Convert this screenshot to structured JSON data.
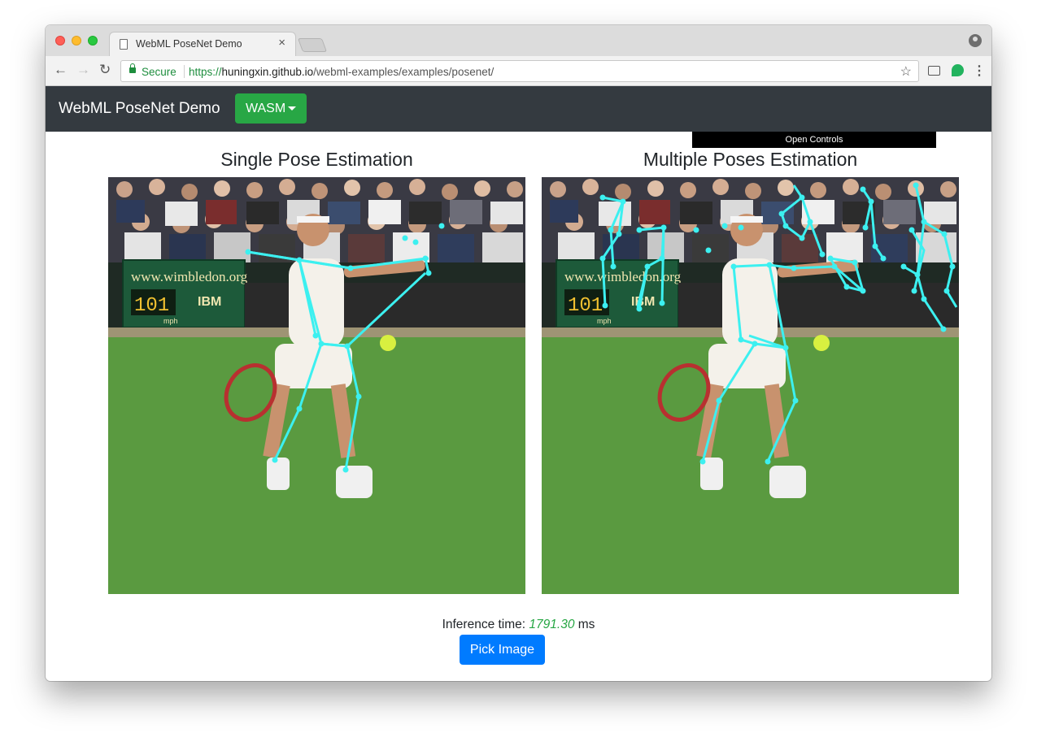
{
  "browser": {
    "tab_title": "WebML PoseNet Demo",
    "tab_close": "×",
    "secure_label": "Secure",
    "url_scheme": "https://",
    "url_host": "huningxin.github.io",
    "url_path": "/webml-examples/examples/posenet/"
  },
  "app": {
    "brand": "WebML PoseNet Demo",
    "backend_button": "WASM",
    "open_controls": "Open Controls"
  },
  "panels": {
    "single_title": "Single Pose Estimation",
    "multi_title": "Multiple Poses Estimation"
  },
  "scene_text": {
    "banner": "www.wimbledon.org",
    "sponsor": "IBM",
    "speed": "101",
    "speed_unit": "mph"
  },
  "footer": {
    "inference_label": "Inference time:",
    "inference_value": "1791.30",
    "inference_unit": "ms",
    "pick_button": "Pick Image"
  },
  "colors": {
    "skeleton": "#3cf0f0",
    "navbar": "#343a40",
    "backend_button": "#28a745",
    "pick_button": "#007bff"
  }
}
